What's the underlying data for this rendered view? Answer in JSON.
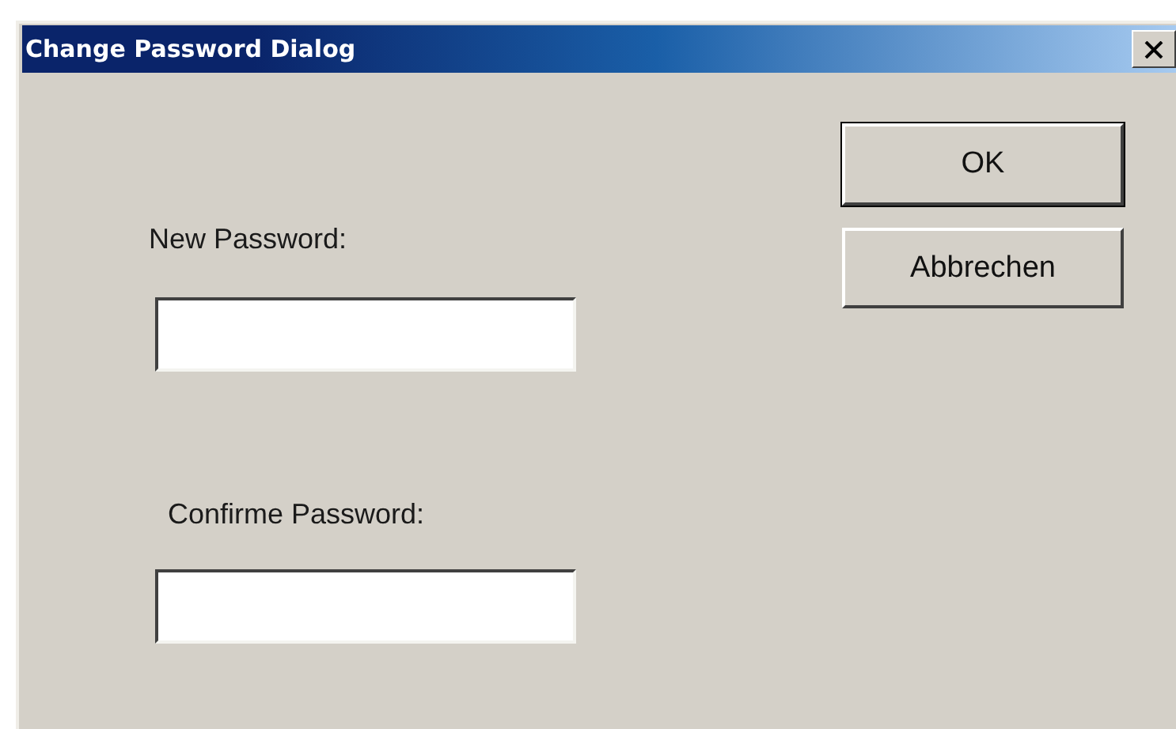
{
  "window": {
    "title": "Change Password Dialog"
  },
  "fields": [
    {
      "label": "New Password:"
    },
    {
      "label": "Confirme Password:"
    }
  ],
  "buttons": [
    {
      "label": "OK",
      "default": true
    },
    {
      "label": "Abbrechen",
      "default": false
    }
  ]
}
